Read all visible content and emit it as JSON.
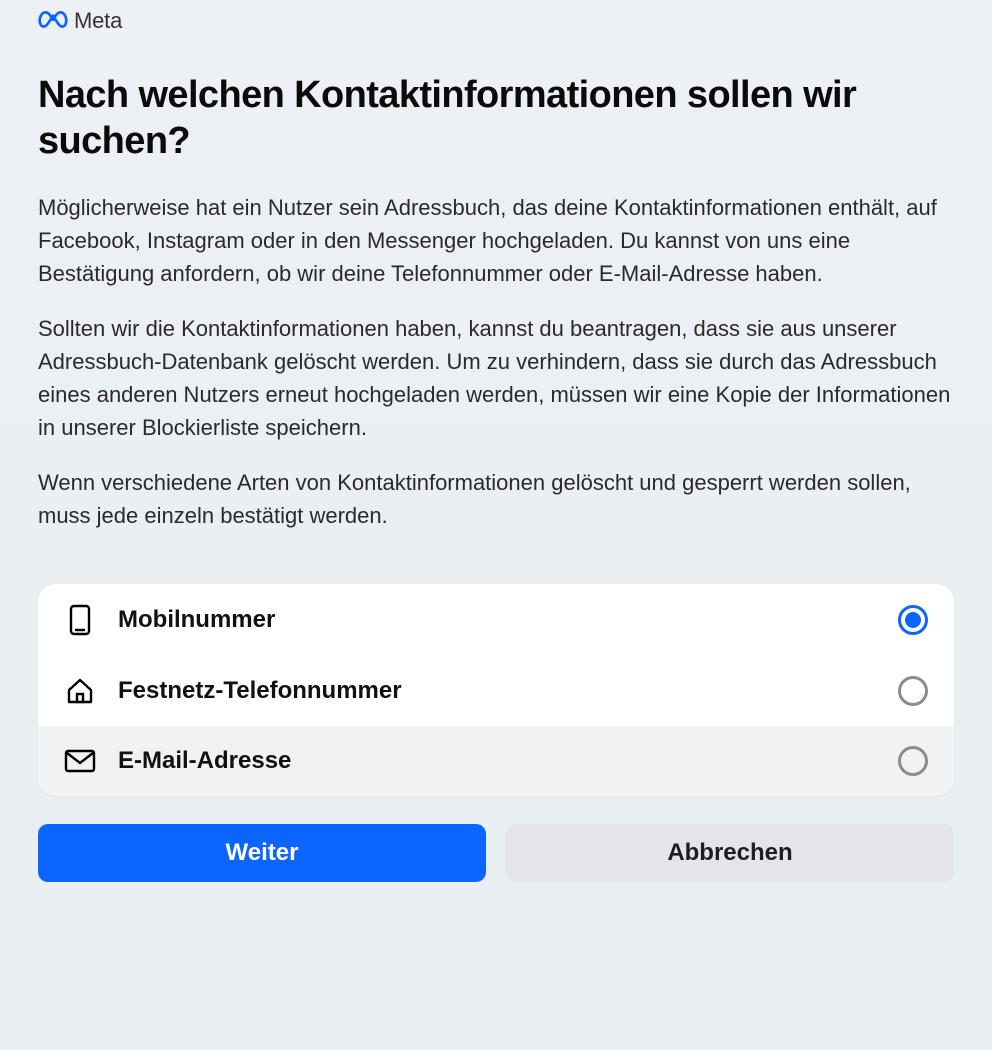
{
  "brand": {
    "name": "Meta"
  },
  "heading": "Nach welchen Kontaktinformationen sollen wir suchen?",
  "paragraphs": [
    "Möglicherweise hat ein Nutzer sein Adressbuch, das deine Kontaktinformationen enthält, auf Facebook, Instagram oder in den Messenger hochgeladen. Du kannst von uns eine Bestätigung anfordern, ob wir deine Telefonnummer oder E-Mail-Adresse haben.",
    "Sollten wir die Kontaktinformationen haben, kannst du beantragen, dass sie aus unserer Adressbuch-Datenbank gelöscht werden. Um zu verhindern, dass sie durch das Adressbuch eines anderen Nutzers erneut hochgeladen werden, müssen wir eine Kopie der Informationen in unserer Blockierliste speichern.",
    "Wenn verschiedene Arten von Kontaktinformationen gelöscht und gesperrt werden sollen, muss jede einzeln bestätigt werden."
  ],
  "options": [
    {
      "label": "Mobilnummer",
      "icon": "mobile",
      "selected": true
    },
    {
      "label": "Festnetz-Telefonnummer",
      "icon": "home",
      "selected": false
    },
    {
      "label": "E-Mail-Adresse",
      "icon": "mail",
      "selected": false
    }
  ],
  "buttons": {
    "primary": "Weiter",
    "secondary": "Abbrechen"
  },
  "colors": {
    "accent": "#0a66ff",
    "secondaryButton": "#e3e5e8"
  }
}
